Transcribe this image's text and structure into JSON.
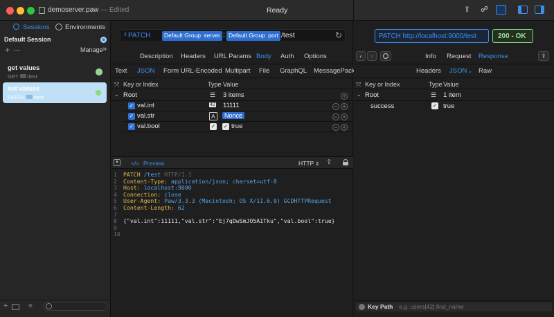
{
  "window": {
    "file_name": "demoserver.paw",
    "edited_suffix": "— Edited",
    "status": "Ready"
  },
  "sidebar": {
    "tab_sessions": "Sessions",
    "tab_environments": "Environments",
    "session_name": "Default Session",
    "add": "+",
    "remove": "—",
    "manage": "Manage",
    "manage_chevron": "»",
    "requests": [
      {
        "name": "get values",
        "method": "GET",
        "path": "/test"
      },
      {
        "name": "set values",
        "method": "PATCH",
        "path": "/test"
      }
    ]
  },
  "request": {
    "method": "PATCH",
    "token1": "Default Group",
    "token1_sub": "server",
    "colon": ":",
    "token2": "Default Group",
    "token2_sub": "port",
    "path": "/test",
    "tabs": [
      "Description",
      "Headers",
      "URL Params",
      "Body",
      "Auth",
      "Options"
    ],
    "body_tabs": [
      "Text",
      "JSON",
      "Form URL-Encoded",
      "Multipart",
      "File",
      "GraphQL",
      "MessagePack"
    ],
    "col_key": "Key or Index",
    "col_type": "Type",
    "col_value": "Value",
    "root_label": "Root",
    "root_type_icon": "☰",
    "root_value": "3 items",
    "rows": [
      {
        "key": "val.int",
        "type": "42",
        "value": "11111"
      },
      {
        "key": "val.str",
        "type": "A",
        "value": "Nonce"
      },
      {
        "key": "val.bool",
        "type": "✓",
        "value": "true"
      }
    ]
  },
  "preview": {
    "toggle": "</>",
    "label": "Preview",
    "format": "HTTP",
    "format_arrows": "⇕",
    "lines": [
      {
        "n": "1",
        "parts": [
          {
            "t": "PATCH",
            "c": "kw"
          },
          {
            "t": " /test ",
            "c": "val"
          },
          {
            "t": "HTTP/1.1",
            "c": "ln"
          }
        ]
      },
      {
        "n": "2",
        "parts": [
          {
            "t": "Content-Type: ",
            "c": "kw"
          },
          {
            "t": "application/json; charset=utf-8",
            "c": "val"
          }
        ]
      },
      {
        "n": "3",
        "parts": [
          {
            "t": "Host: ",
            "c": "kw"
          },
          {
            "t": "localhost:9000",
            "c": "val"
          }
        ]
      },
      {
        "n": "4",
        "parts": [
          {
            "t": "Connection: ",
            "c": "kw"
          },
          {
            "t": "close",
            "c": "val"
          }
        ]
      },
      {
        "n": "5",
        "parts": [
          {
            "t": "User-Agent: ",
            "c": "kw"
          },
          {
            "t": "Paw/3.3.3 (Macintosh; OS X/11.6.0) GCDHTTPRequest",
            "c": "val"
          }
        ]
      },
      {
        "n": "6",
        "parts": [
          {
            "t": "Content-Length: ",
            "c": "kw"
          },
          {
            "t": "62",
            "c": "val"
          }
        ]
      },
      {
        "n": "7",
        "parts": []
      },
      {
        "n": "8",
        "parts": [
          {
            "t": "{\"val.int\":11111,\"val.str\":\"Ej7qDwSmJO5A1Tku\",\"val.bool\":true}",
            "c": "plain"
          }
        ]
      },
      {
        "n": "9",
        "parts": []
      },
      {
        "n": "10",
        "parts": []
      }
    ]
  },
  "response": {
    "url": "PATCH http://localhost:9000/test",
    "status": "200 - OK",
    "tabs": [
      "Info",
      "Request",
      "Response"
    ],
    "sub_tabs": [
      "Headers",
      "JSON",
      "Raw"
    ],
    "json_chevron": "⌄",
    "col_key": "Key or Index",
    "col_type": "Type",
    "col_value": "Value",
    "root_label": "Root",
    "root_value": "1 item",
    "rows": [
      {
        "key": "success",
        "type": "✓",
        "value": "true"
      }
    ],
    "key_path_label": "Key Path",
    "key_path_placeholder": "e.g. users[42].first_name"
  },
  "colors": {
    "accent": "#3d8ef0",
    "status_green": "#8bd68b"
  }
}
